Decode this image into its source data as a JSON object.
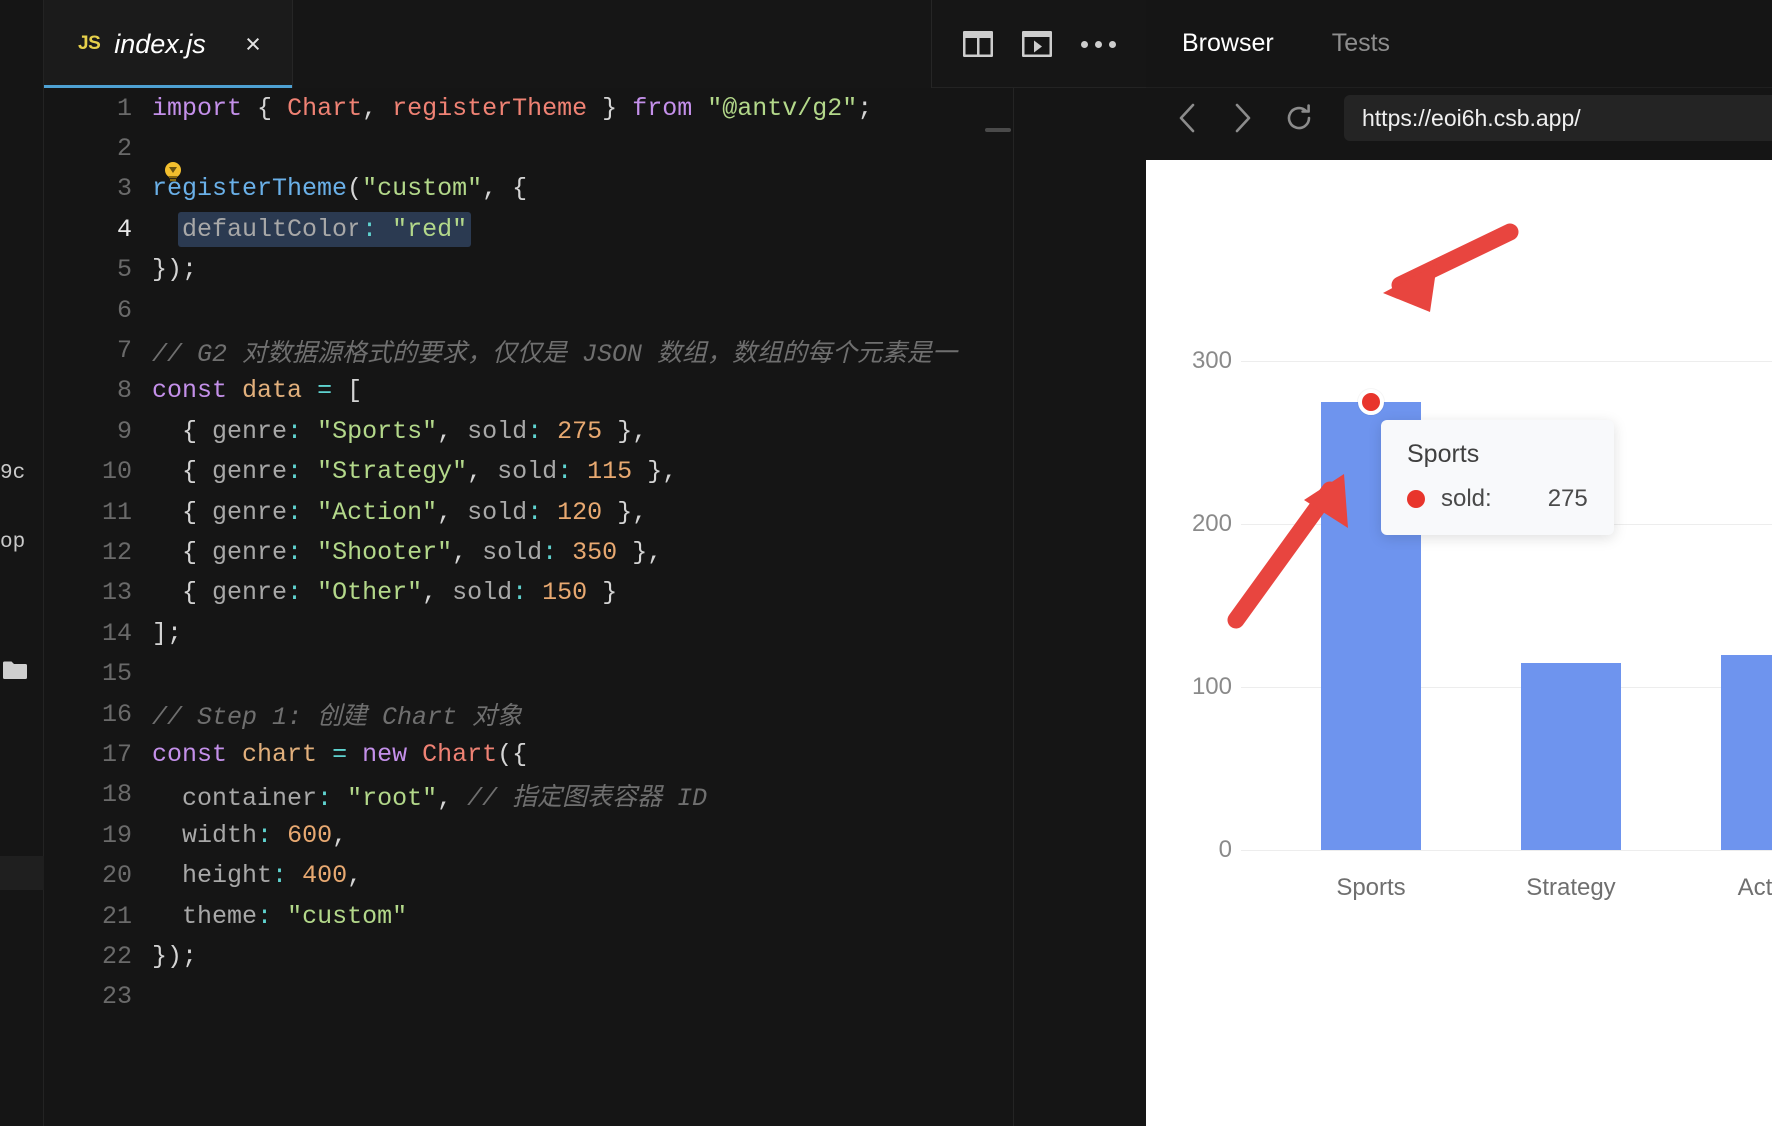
{
  "editor": {
    "tab": {
      "filetype_icon": "js-file-icon",
      "filename": "index.js",
      "close_label": "×"
    },
    "actions": {
      "split_pane": "split-pane-icon",
      "preview": "preview-icon",
      "more": "more-options-icon"
    },
    "rail": {
      "ghost_text_1": "9c",
      "ghost_text_2": "op"
    },
    "code_lines": [
      {
        "n": "1",
        "tokens": [
          {
            "t": "import",
            "c": "kw"
          },
          {
            "t": " ",
            "c": "punc"
          },
          {
            "t": "{",
            "c": "punc"
          },
          {
            "t": " ",
            "c": "punc"
          },
          {
            "t": "Chart",
            "c": "cls"
          },
          {
            "t": ",",
            "c": "punc"
          },
          {
            "t": " ",
            "c": "punc"
          },
          {
            "t": "registerTheme",
            "c": "cls"
          },
          {
            "t": " ",
            "c": "punc"
          },
          {
            "t": "}",
            "c": "punc"
          },
          {
            "t": " ",
            "c": "punc"
          },
          {
            "t": "from",
            "c": "kw"
          },
          {
            "t": " ",
            "c": "punc"
          },
          {
            "t": "\"@antv/g2\"",
            "c": "str"
          },
          {
            "t": ";",
            "c": "punc"
          }
        ]
      },
      {
        "n": "2",
        "tokens": []
      },
      {
        "n": "3",
        "tokens": [
          {
            "t": "registerTheme",
            "c": "fn"
          },
          {
            "t": "(",
            "c": "punc"
          },
          {
            "t": "\"custom\"",
            "c": "str"
          },
          {
            "t": ",",
            "c": "punc"
          },
          {
            "t": " ",
            "c": "punc"
          },
          {
            "t": "{",
            "c": "punc"
          }
        ],
        "bulb": true
      },
      {
        "n": "4",
        "tokens": [
          {
            "t": "  ",
            "c": "punc"
          },
          {
            "t": "defaultColor",
            "c": "prop",
            "sel": true
          },
          {
            "t": ":",
            "c": "op",
            "sel": true
          },
          {
            "t": " ",
            "c": "punc",
            "sel": true
          },
          {
            "t": "\"red\"",
            "c": "str",
            "sel": true
          }
        ]
      },
      {
        "n": "5",
        "tokens": [
          {
            "t": "});",
            "c": "punc"
          }
        ]
      },
      {
        "n": "6",
        "tokens": []
      },
      {
        "n": "7",
        "tokens": [
          {
            "t": "// G2 对数据源格式的要求，仅仅是 JSON 数组，数组的每个元素是一",
            "c": "cmt"
          }
        ]
      },
      {
        "n": "8",
        "tokens": [
          {
            "t": "const",
            "c": "kw"
          },
          {
            "t": " ",
            "c": "punc"
          },
          {
            "t": "data",
            "c": "var"
          },
          {
            "t": " ",
            "c": "punc"
          },
          {
            "t": "=",
            "c": "op"
          },
          {
            "t": " ",
            "c": "punc"
          },
          {
            "t": "[",
            "c": "punc"
          }
        ]
      },
      {
        "n": "9",
        "tokens": [
          {
            "t": "  { ",
            "c": "punc"
          },
          {
            "t": "genre",
            "c": "prop"
          },
          {
            "t": ":",
            "c": "op"
          },
          {
            "t": " ",
            "c": "punc"
          },
          {
            "t": "\"Sports\"",
            "c": "str"
          },
          {
            "t": ",",
            "c": "punc"
          },
          {
            "t": " ",
            "c": "punc"
          },
          {
            "t": "sold",
            "c": "prop"
          },
          {
            "t": ":",
            "c": "op"
          },
          {
            "t": " ",
            "c": "punc"
          },
          {
            "t": "275",
            "c": "num"
          },
          {
            "t": " },",
            "c": "punc"
          }
        ]
      },
      {
        "n": "10",
        "tokens": [
          {
            "t": "  { ",
            "c": "punc"
          },
          {
            "t": "genre",
            "c": "prop"
          },
          {
            "t": ":",
            "c": "op"
          },
          {
            "t": " ",
            "c": "punc"
          },
          {
            "t": "\"Strategy\"",
            "c": "str"
          },
          {
            "t": ",",
            "c": "punc"
          },
          {
            "t": " ",
            "c": "punc"
          },
          {
            "t": "sold",
            "c": "prop"
          },
          {
            "t": ":",
            "c": "op"
          },
          {
            "t": " ",
            "c": "punc"
          },
          {
            "t": "115",
            "c": "num"
          },
          {
            "t": " },",
            "c": "punc"
          }
        ]
      },
      {
        "n": "11",
        "tokens": [
          {
            "t": "  { ",
            "c": "punc"
          },
          {
            "t": "genre",
            "c": "prop"
          },
          {
            "t": ":",
            "c": "op"
          },
          {
            "t": " ",
            "c": "punc"
          },
          {
            "t": "\"Action\"",
            "c": "str"
          },
          {
            "t": ",",
            "c": "punc"
          },
          {
            "t": " ",
            "c": "punc"
          },
          {
            "t": "sold",
            "c": "prop"
          },
          {
            "t": ":",
            "c": "op"
          },
          {
            "t": " ",
            "c": "punc"
          },
          {
            "t": "120",
            "c": "num"
          },
          {
            "t": " },",
            "c": "punc"
          }
        ]
      },
      {
        "n": "12",
        "tokens": [
          {
            "t": "  { ",
            "c": "punc"
          },
          {
            "t": "genre",
            "c": "prop"
          },
          {
            "t": ":",
            "c": "op"
          },
          {
            "t": " ",
            "c": "punc"
          },
          {
            "t": "\"Shooter\"",
            "c": "str"
          },
          {
            "t": ",",
            "c": "punc"
          },
          {
            "t": " ",
            "c": "punc"
          },
          {
            "t": "sold",
            "c": "prop"
          },
          {
            "t": ":",
            "c": "op"
          },
          {
            "t": " ",
            "c": "punc"
          },
          {
            "t": "350",
            "c": "num"
          },
          {
            "t": " },",
            "c": "punc"
          }
        ]
      },
      {
        "n": "13",
        "tokens": [
          {
            "t": "  { ",
            "c": "punc"
          },
          {
            "t": "genre",
            "c": "prop"
          },
          {
            "t": ":",
            "c": "op"
          },
          {
            "t": " ",
            "c": "punc"
          },
          {
            "t": "\"Other\"",
            "c": "str"
          },
          {
            "t": ",",
            "c": "punc"
          },
          {
            "t": " ",
            "c": "punc"
          },
          {
            "t": "sold",
            "c": "prop"
          },
          {
            "t": ":",
            "c": "op"
          },
          {
            "t": " ",
            "c": "punc"
          },
          {
            "t": "150",
            "c": "num"
          },
          {
            "t": " }",
            "c": "punc"
          }
        ]
      },
      {
        "n": "14",
        "tokens": [
          {
            "t": "];",
            "c": "punc"
          }
        ]
      },
      {
        "n": "15",
        "tokens": []
      },
      {
        "n": "16",
        "tokens": [
          {
            "t": "// Step 1: 创建 Chart 对象",
            "c": "cmt"
          }
        ]
      },
      {
        "n": "17",
        "tokens": [
          {
            "t": "const",
            "c": "kw"
          },
          {
            "t": " ",
            "c": "punc"
          },
          {
            "t": "chart",
            "c": "var"
          },
          {
            "t": " ",
            "c": "punc"
          },
          {
            "t": "=",
            "c": "op"
          },
          {
            "t": " ",
            "c": "punc"
          },
          {
            "t": "new",
            "c": "kw"
          },
          {
            "t": " ",
            "c": "punc"
          },
          {
            "t": "Chart",
            "c": "cls"
          },
          {
            "t": "({",
            "c": "punc"
          }
        ]
      },
      {
        "n": "18",
        "tokens": [
          {
            "t": "  ",
            "c": "punc"
          },
          {
            "t": "container",
            "c": "prop"
          },
          {
            "t": ":",
            "c": "op"
          },
          {
            "t": " ",
            "c": "punc"
          },
          {
            "t": "\"root\"",
            "c": "str"
          },
          {
            "t": ",",
            "c": "punc"
          },
          {
            "t": " ",
            "c": "punc"
          },
          {
            "t": "// 指定图表容器 ID",
            "c": "cmt"
          }
        ]
      },
      {
        "n": "19",
        "tokens": [
          {
            "t": "  ",
            "c": "punc"
          },
          {
            "t": "width",
            "c": "prop"
          },
          {
            "t": ":",
            "c": "op"
          },
          {
            "t": " ",
            "c": "punc"
          },
          {
            "t": "600",
            "c": "num"
          },
          {
            "t": ",",
            "c": "punc"
          }
        ]
      },
      {
        "n": "20",
        "tokens": [
          {
            "t": "  ",
            "c": "punc"
          },
          {
            "t": "height",
            "c": "prop"
          },
          {
            "t": ":",
            "c": "op"
          },
          {
            "t": " ",
            "c": "punc"
          },
          {
            "t": "400",
            "c": "num"
          },
          {
            "t": ",",
            "c": "punc"
          }
        ]
      },
      {
        "n": "21",
        "tokens": [
          {
            "t": "  ",
            "c": "punc"
          },
          {
            "t": "theme",
            "c": "prop"
          },
          {
            "t": ":",
            "c": "op"
          },
          {
            "t": " ",
            "c": "punc"
          },
          {
            "t": "\"custom\"",
            "c": "str"
          }
        ]
      },
      {
        "n": "22",
        "tokens": [
          {
            "t": "});",
            "c": "punc"
          }
        ]
      },
      {
        "n": "23",
        "tokens": []
      }
    ]
  },
  "browser": {
    "tabs": [
      {
        "label": "Browser",
        "active": true
      },
      {
        "label": "Tests",
        "active": false
      }
    ],
    "nav": {
      "back": "back-arrow-icon",
      "forward": "forward-arrow-icon",
      "reload": "reload-icon"
    },
    "url": "https://eoi6h.csb.app/"
  },
  "chart_data": {
    "type": "bar",
    "categories": [
      "Sports",
      "Strategy",
      "Action"
    ],
    "values": [
      275,
      115,
      120
    ],
    "title": "",
    "xlabel": "",
    "ylabel": "",
    "ylim": [
      0,
      350
    ],
    "yticks": [
      "0",
      "100",
      "200",
      "300"
    ],
    "grid": true,
    "legend": "none",
    "bar_color": "#6e94ee",
    "highlighted_category": "Sports"
  },
  "tooltip": {
    "title": "Sports",
    "marker_color": "#e8352c",
    "label": "sold:",
    "value": "275"
  },
  "annotations": {
    "arrow_color": "#e8453f",
    "arrow_1_target": "tooltip",
    "arrow_2_target": "sports-bar"
  }
}
